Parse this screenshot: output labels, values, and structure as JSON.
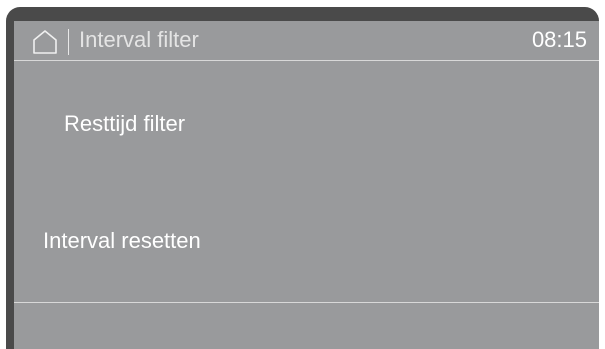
{
  "header": {
    "home_icon": "home-icon",
    "title": "Interval filter",
    "time": "08:15"
  },
  "menu": {
    "items": [
      {
        "label": "Resttijd filter"
      },
      {
        "label": "Interval resetten"
      }
    ]
  },
  "colors": {
    "screen_background": "#999a9c",
    "bezel": "#4a4a4a",
    "text": "#ffffff"
  }
}
